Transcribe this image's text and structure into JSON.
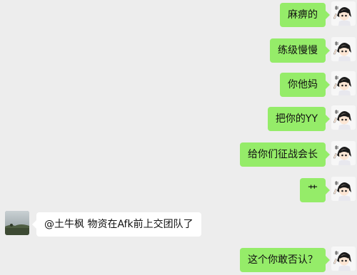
{
  "conversation": {
    "self_avatar": "chibi-character-avatar",
    "contact_avatar": "landscape-photo-avatar",
    "messages": [
      {
        "from": "self",
        "text": "麻痹的"
      },
      {
        "from": "self",
        "text": "练级慢慢"
      },
      {
        "from": "self",
        "text": "你他妈"
      },
      {
        "from": "self",
        "text": "把你的YY"
      },
      {
        "from": "self",
        "text": "给你们征战会长"
      },
      {
        "from": "self",
        "text": "艹"
      },
      {
        "from": "contact",
        "text": "@土牛枫 物资在Afk前上交团队了"
      },
      {
        "from": "self",
        "text": "这个你敢否认？"
      }
    ]
  },
  "colors": {
    "background": "#ededed",
    "outgoing_bubble": "#95ec69",
    "incoming_bubble": "#ffffff"
  }
}
